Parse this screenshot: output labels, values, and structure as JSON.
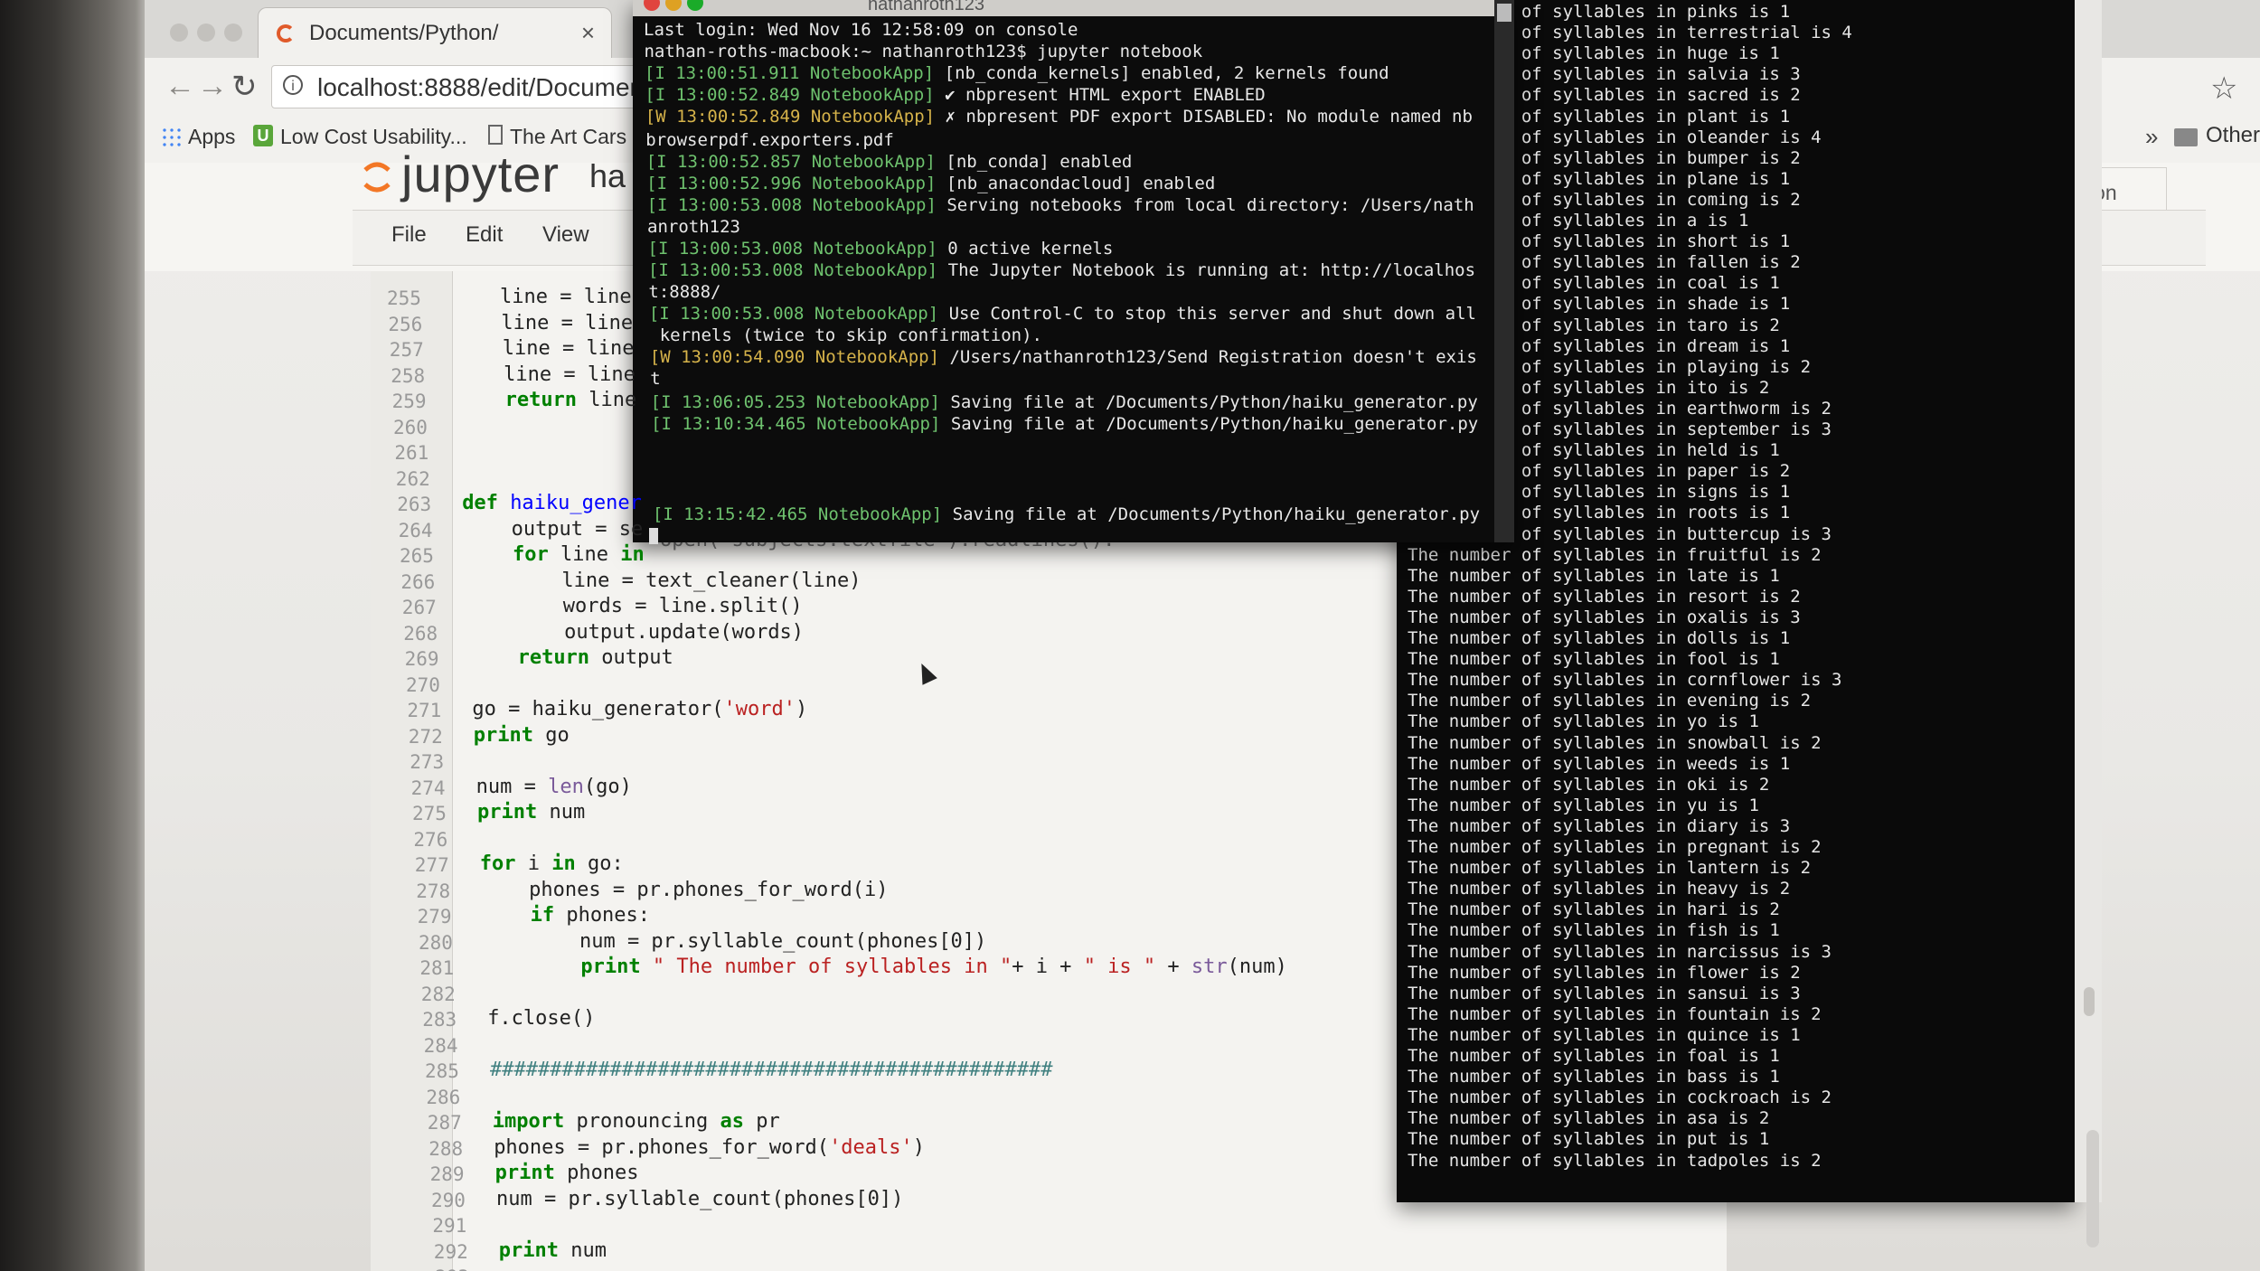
{
  "browser": {
    "tab_title": "Documents/Python/",
    "tab_close": "×",
    "url": "localhost:8888/edit/Documents",
    "bookmarks": {
      "apps": "Apps",
      "low_cost": "Low Cost Usability...",
      "art_cars": "The Art Cars",
      "more": "»",
      "other": "Other"
    }
  },
  "jupyter": {
    "logo_text": "jupyter",
    "notebook_title": "ha",
    "kernel": "Python",
    "menu": [
      "File",
      "Edit",
      "View"
    ]
  },
  "editor": {
    "lines": [
      {
        "n": "255",
        "segments": [
          {
            "t": "    line = line",
            "c": ""
          }
        ]
      },
      {
        "n": "256",
        "segments": [
          {
            "t": "    line = line",
            "c": ""
          }
        ]
      },
      {
        "n": "257",
        "segments": [
          {
            "t": "    line = line",
            "c": ""
          }
        ]
      },
      {
        "n": "258",
        "segments": [
          {
            "t": "    line = line",
            "c": ""
          }
        ]
      },
      {
        "n": "259",
        "segments": [
          {
            "t": "    ",
            "c": ""
          },
          {
            "t": "return",
            "c": "kw"
          },
          {
            "t": " line",
            "c": ""
          }
        ]
      },
      {
        "n": "260",
        "segments": []
      },
      {
        "n": "261",
        "segments": []
      },
      {
        "n": "262",
        "segments": []
      },
      {
        "n": "263",
        "segments": [
          {
            "t": "def",
            "c": "kw"
          },
          {
            "t": " ",
            "c": ""
          },
          {
            "t": "haiku_gener",
            "c": "fn"
          }
        ]
      },
      {
        "n": "264",
        "segments": [
          {
            "t": "    output = se",
            "c": ""
          }
        ]
      },
      {
        "n": "265",
        "segments": [
          {
            "t": "    ",
            "c": ""
          },
          {
            "t": "for",
            "c": "kw"
          },
          {
            "t": " line ",
            "c": ""
          },
          {
            "t": "in",
            "c": "kw"
          }
        ]
      },
      {
        "n": "266",
        "segments": [
          {
            "t": "        line = text_cleaner(line)",
            "c": ""
          }
        ]
      },
      {
        "n": "267",
        "segments": [
          {
            "t": "        words = line.split()",
            "c": ""
          }
        ]
      },
      {
        "n": "268",
        "segments": [
          {
            "t": "        output.update(words)",
            "c": ""
          }
        ]
      },
      {
        "n": "269",
        "segments": [
          {
            "t": "    ",
            "c": ""
          },
          {
            "t": "return",
            "c": "kw"
          },
          {
            "t": " output",
            "c": ""
          }
        ]
      },
      {
        "n": "270",
        "segments": []
      },
      {
        "n": "271",
        "segments": [
          {
            "t": "go = haiku_generator(",
            "c": ""
          },
          {
            "t": "'word'",
            "c": "str"
          },
          {
            "t": ")",
            "c": ""
          }
        ]
      },
      {
        "n": "272",
        "segments": [
          {
            "t": "print",
            "c": "kw"
          },
          {
            "t": " go",
            "c": ""
          }
        ]
      },
      {
        "n": "273",
        "segments": []
      },
      {
        "n": "274",
        "segments": [
          {
            "t": "num = ",
            "c": ""
          },
          {
            "t": "len",
            "c": "bi"
          },
          {
            "t": "(go)",
            "c": ""
          }
        ]
      },
      {
        "n": "275",
        "segments": [
          {
            "t": "print",
            "c": "kw"
          },
          {
            "t": " num",
            "c": ""
          }
        ]
      },
      {
        "n": "276",
        "segments": []
      },
      {
        "n": "277",
        "segments": [
          {
            "t": "for",
            "c": "kw"
          },
          {
            "t": " i ",
            "c": ""
          },
          {
            "t": "in",
            "c": "kw"
          },
          {
            "t": " go:",
            "c": ""
          }
        ]
      },
      {
        "n": "278",
        "segments": [
          {
            "t": "    phones = pr.phones_for_word(i)",
            "c": ""
          }
        ]
      },
      {
        "n": "279",
        "segments": [
          {
            "t": "    ",
            "c": ""
          },
          {
            "t": "if",
            "c": "kw"
          },
          {
            "t": " phones:",
            "c": ""
          }
        ]
      },
      {
        "n": "280",
        "segments": [
          {
            "t": "        num = pr.syllable_count(phones[0])",
            "c": ""
          }
        ]
      },
      {
        "n": "281",
        "segments": [
          {
            "t": "        ",
            "c": ""
          },
          {
            "t": "print",
            "c": "kw"
          },
          {
            "t": " ",
            "c": ""
          },
          {
            "t": "\" The number of syllables in \"",
            "c": "str"
          },
          {
            "t": "+ i + ",
            "c": ""
          },
          {
            "t": "\" is \"",
            "c": "str"
          },
          {
            "t": " + ",
            "c": ""
          },
          {
            "t": "str",
            "c": "bi"
          },
          {
            "t": "(num)",
            "c": ""
          }
        ]
      },
      {
        "n": "282",
        "segments": []
      },
      {
        "n": "283",
        "segments": [
          {
            "t": "f.close()",
            "c": ""
          }
        ]
      },
      {
        "n": "284",
        "segments": []
      },
      {
        "n": "285",
        "segments": [
          {
            "t": "###############################################",
            "c": "cm"
          }
        ]
      },
      {
        "n": "286",
        "segments": []
      },
      {
        "n": "287",
        "segments": [
          {
            "t": "import",
            "c": "kw"
          },
          {
            "t": " pronouncing ",
            "c": ""
          },
          {
            "t": "as",
            "c": "kw"
          },
          {
            "t": " pr",
            "c": ""
          }
        ]
      },
      {
        "n": "288",
        "segments": [
          {
            "t": "phones = pr.phones_for_word(",
            "c": ""
          },
          {
            "t": "'deals'",
            "c": "str"
          },
          {
            "t": ")",
            "c": ""
          }
        ]
      },
      {
        "n": "289",
        "segments": [
          {
            "t": "print",
            "c": "kw"
          },
          {
            "t": " phones",
            "c": ""
          }
        ]
      },
      {
        "n": "290",
        "segments": [
          {
            "t": "num = pr.syllable_count(phones[0])",
            "c": ""
          }
        ]
      },
      {
        "n": "291",
        "segments": []
      },
      {
        "n": "292",
        "segments": [
          {
            "t": "print",
            "c": "kw"
          },
          {
            "t": " num",
            "c": ""
          }
        ]
      },
      {
        "n": "293",
        "segments": []
      }
    ],
    "overlap_text": "open( subjects.textfile ).readlines():"
  },
  "terminal1": {
    "title": "nathanroth123",
    "lines": [
      {
        "tag": "",
        "text": "Last login: Wed Nov 16 12:58:09 on console"
      },
      {
        "tag": "",
        "text": "nathan-roths-macbook:~ nathanroth123$ jupyter notebook"
      },
      {
        "tag": "[I 13:00:51.911 NotebookApp]",
        "text": " [nb_conda_kernels] enabled, 2 kernels found"
      },
      {
        "tag": "[I 13:00:52.849 NotebookApp]",
        "text": " ✔ nbpresent HTML export ENABLED"
      },
      {
        "tag": "[W 13:00:52.849 NotebookApp]",
        "warn": true,
        "text": " ✗ nbpresent PDF export DISABLED: No module named nb"
      },
      {
        "tag": "",
        "text": "browserpdf.exporters.pdf"
      },
      {
        "tag": "[I 13:00:52.857 NotebookApp]",
        "text": " [nb_conda] enabled"
      },
      {
        "tag": "[I 13:00:52.996 NotebookApp]",
        "text": " [nb_anacondacloud] enabled"
      },
      {
        "tag": "[I 13:00:53.008 NotebookApp]",
        "text": " Serving notebooks from local directory: /Users/nath"
      },
      {
        "tag": "",
        "text": "anroth123"
      },
      {
        "tag": "[I 13:00:53.008 NotebookApp]",
        "text": " 0 active kernels"
      },
      {
        "tag": "[I 13:00:53.008 NotebookApp]",
        "text": " The Jupyter Notebook is running at: http://localhos"
      },
      {
        "tag": "",
        "text": "t:8888/"
      },
      {
        "tag": "[I 13:00:53.008 NotebookApp]",
        "text": " Use Control-C to stop this server and shut down all"
      },
      {
        "tag": "",
        "text": " kernels (twice to skip confirmation)."
      },
      {
        "tag": "[W 13:00:54.090 NotebookApp]",
        "warn": true,
        "text": " /Users/nathanroth123/Send Registration doesn't exis"
      },
      {
        "tag": "",
        "text": "t"
      },
      {
        "tag": "[I 13:06:05.253 NotebookApp]",
        "text": " Saving file at /Documents/Python/haiku_generator.py"
      },
      {
        "tag": "[I 13:10:34.465 NotebookApp]",
        "text": " Saving file at /Documents/Python/haiku_generator.py"
      },
      {
        "tag": "",
        "text": ""
      },
      {
        "tag": "",
        "text": ""
      },
      {
        "tag": "",
        "text": ""
      },
      {
        "tag": "[I 13:15:42.465 NotebookApp]",
        "text": " Saving file at /Documents/Python/haiku_generator.py"
      }
    ]
  },
  "terminal2": {
    "lines": [
      "The number of syllables in pinks is 1",
      "The number of syllables in terrestrial is 4",
      "The number of syllables in huge is 1",
      "The number of syllables in salvia is 3",
      "The number of syllables in sacred is 2",
      "The number of syllables in plant is 1",
      "The number of syllables in oleander is 4",
      "The number of syllables in bumper is 2",
      "The number of syllables in plane is 1",
      "The number of syllables in coming is 2",
      "The number of syllables in a is 1",
      "The number of syllables in short is 1",
      "The number of syllables in fallen is 2",
      "The number of syllables in coal is 1",
      "The number of syllables in shade is 1",
      "The number of syllables in taro is 2",
      "The number of syllables in dream is 1",
      "The number of syllables in playing is 2",
      "The number of syllables in ito is 2",
      "The number of syllables in earthworm is 2",
      "The number of syllables in september is 3",
      "The number of syllables in held is 1",
      "The number of syllables in paper is 2",
      "The number of syllables in signs is 1",
      "The number of syllables in roots is 1",
      "The number of syllables in buttercup is 3",
      "The number of syllables in fruitful is 2",
      "The number of syllables in late is 1",
      "The number of syllables in resort is 2",
      "The number of syllables in oxalis is 3",
      "The number of syllables in dolls is 1",
      "The number of syllables in fool is 1",
      "The number of syllables in cornflower is 3",
      "The number of syllables in evening is 2",
      "The number of syllables in yo is 1",
      "The number of syllables in snowball is 2",
      "The number of syllables in weeds is 1",
      "The number of syllables in oki is 2",
      "The number of syllables in yu is 1",
      "The number of syllables in diary is 3",
      "The number of syllables in pregnant is 2",
      "The number of syllables in lantern is 2",
      "The number of syllables in heavy is 2",
      "The number of syllables in hari is 2",
      "The number of syllables in fish is 1",
      "The number of syllables in narcissus is 3",
      "The number of syllables in flower is 2",
      "The number of syllables in sansui is 3",
      "The number of syllables in fountain is 2",
      "The number of syllables in quince is 1",
      "The number of syllables in foal is 1",
      "The number of syllables in bass is 1",
      "The number of syllables in cockroach is 2",
      "The number of syllables in asa is 2",
      "The number of syllables in put is 1",
      "The number of syllables in tadpoles is 2"
    ]
  },
  "colors": {
    "terminal_bg": "#0c0c0c",
    "terminal_tag_green": "#6ec26e",
    "terminal_tag_warn": "#d6b34a",
    "jupyter_orange": "#f37726"
  }
}
